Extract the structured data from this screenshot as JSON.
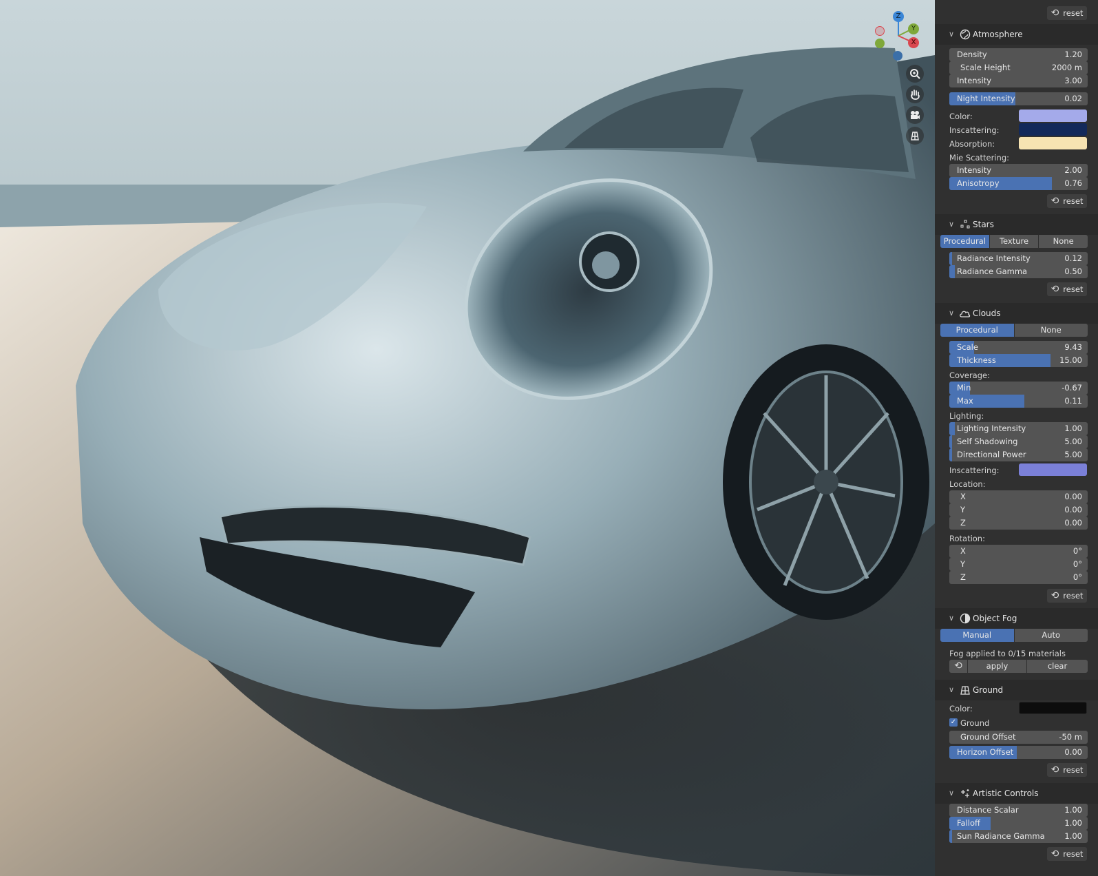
{
  "top_reset": "reset",
  "atmosphere": {
    "title": "Atmosphere",
    "density": {
      "label": "Density",
      "value": "1.20"
    },
    "scale_height": {
      "label": "Scale Height",
      "value": "2000 m"
    },
    "intensity": {
      "label": "Intensity",
      "value": "3.00"
    },
    "night_intensity": {
      "label": "Night Intensity",
      "value": "0.02"
    },
    "color_label": "Color:",
    "inscattering_label": "Inscattering:",
    "absorption_label": "Absorption:",
    "mie_label": "Mie Scattering:",
    "mie_intensity": {
      "label": "Intensity",
      "value": "2.00"
    },
    "anisotropy": {
      "label": "Anisotropy",
      "value": "0.76"
    },
    "reset": "reset",
    "colors": {
      "color": "#a4aaea",
      "inscattering": "#13295a",
      "absorption": "#f6e3b2"
    }
  },
  "stars": {
    "title": "Stars",
    "modes": [
      "Procedural",
      "Texture",
      "None"
    ],
    "radiance_intensity": {
      "label": "Radiance Intensity",
      "value": "0.12"
    },
    "radiance_gamma": {
      "label": "Radiance Gamma",
      "value": "0.50"
    },
    "reset": "reset"
  },
  "clouds": {
    "title": "Clouds",
    "modes": [
      "Procedural",
      "None"
    ],
    "scale": {
      "label": "Scale",
      "value": "9.43"
    },
    "thickness": {
      "label": "Thickness",
      "value": "15.00"
    },
    "coverage_label": "Coverage:",
    "min": {
      "label": "Min",
      "value": "-0.67"
    },
    "max": {
      "label": "Max",
      "value": "0.11"
    },
    "lighting_label": "Lighting:",
    "lighting_intensity": {
      "label": "Lighting Intensity",
      "value": "1.00"
    },
    "self_shadowing": {
      "label": "Self Shadowing",
      "value": "5.00"
    },
    "directional_power": {
      "label": "Directional Power",
      "value": "5.00"
    },
    "inscattering_label": "Inscattering:",
    "inscattering_color": "#7b80d8",
    "location_label": "Location:",
    "loc_x": {
      "label": "X",
      "value": "0.00"
    },
    "loc_y": {
      "label": "Y",
      "value": "0.00"
    },
    "loc_z": {
      "label": "Z",
      "value": "0.00"
    },
    "rotation_label": "Rotation:",
    "rot_x": {
      "label": "X",
      "value": "0°"
    },
    "rot_y": {
      "label": "Y",
      "value": "0°"
    },
    "rot_z": {
      "label": "Z",
      "value": "0°"
    },
    "reset": "reset"
  },
  "object_fog": {
    "title": "Object Fog",
    "modes": [
      "Manual",
      "Auto"
    ],
    "status": "Fog applied to 0/15 materials",
    "apply": "apply",
    "clear": "clear"
  },
  "ground": {
    "title": "Ground",
    "color_label": "Color:",
    "color": "#0d0d0d",
    "checkbox_label": "Ground",
    "ground_offset": {
      "label": "Ground Offset",
      "value": "-50 m"
    },
    "horizon_offset": {
      "label": "Horizon Offset",
      "value": "0.00"
    },
    "reset": "reset"
  },
  "artistic": {
    "title": "Artistic Controls",
    "distance_scalar": {
      "label": "Distance Scalar",
      "value": "1.00"
    },
    "falloff": {
      "label": "Falloff",
      "value": "1.00"
    },
    "sun_radiance_gamma": {
      "label": "Sun Radiance Gamma",
      "value": "1.00"
    },
    "reset": "reset"
  },
  "gizmo": {
    "z": "Z",
    "y": "Y",
    "x": "X"
  },
  "slider_levels": {
    "night_intensity": 0.48,
    "anisotropy": 0.74,
    "radiance_intensity": 0.02,
    "radiance_gamma": 0.04,
    "scale": 0.18,
    "thickness": 0.73,
    "min": 0.15,
    "max": 0.54,
    "lighting_intensity": 0.04,
    "self_shadowing": 0.02,
    "directional_power": 0.02,
    "horizon_offset": 0.49,
    "falloff": 0.3,
    "sun_radiance_gamma": 0.02
  }
}
